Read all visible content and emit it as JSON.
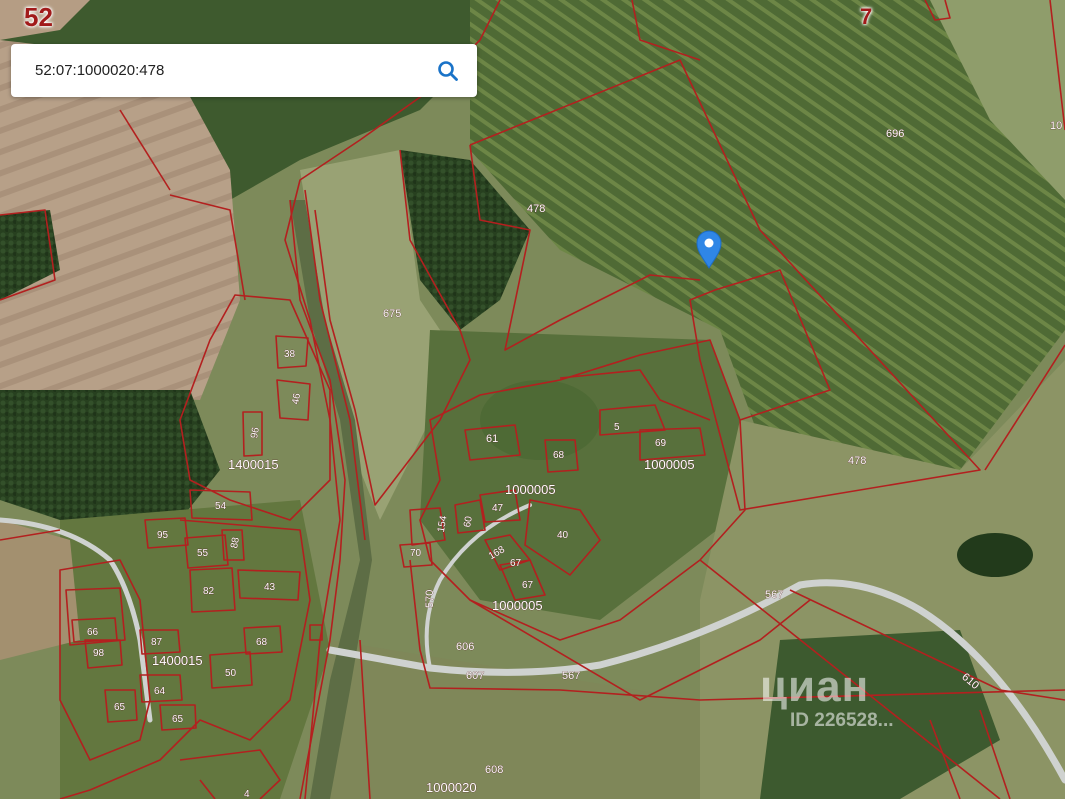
{
  "search": {
    "value": "52:07:1000020:478",
    "icon": "search-icon",
    "icon_color": "#1a73c8"
  },
  "marker": {
    "icon": "location-pin-icon",
    "color": "#2f86e6"
  },
  "regions": {
    "left": "52",
    "right": "7",
    "edge": "10"
  },
  "parcel_labels": {
    "p696": "696",
    "p478a": "478",
    "p478b": "478",
    "p675": "675",
    "p61": "61",
    "p5": "5",
    "p69": "69",
    "p68a": "68",
    "p1000005a": "1000005",
    "p1000005b": "1000005",
    "p1000005c": "1000005",
    "p154": "154",
    "p60": "60",
    "p47": "47",
    "p40": "40",
    "p70": "70",
    "p168": "168",
    "p67a": "67",
    "p67b": "67",
    "p570": "570",
    "p567a": "567",
    "p567b": "567",
    "p606": "606",
    "p607": "607",
    "p610": "610",
    "p608": "608",
    "p1000020": "1000020",
    "p38": "38",
    "p46": "46",
    "p96": "96",
    "p1400015a": "1400015",
    "p1400015b": "1400015",
    "p54": "54",
    "p95": "95",
    "p55": "55",
    "p88": "88",
    "p82": "82",
    "p43": "43",
    "p66": "66",
    "p87": "87",
    "p68b": "68",
    "p98": "98",
    "p50": "50",
    "p64": "64",
    "p65a": "65",
    "p65b": "65",
    "p4": "4"
  },
  "watermark": {
    "logo": "циан",
    "id": "ID 226528..."
  },
  "colors": {
    "boundary": "#b3201f",
    "road": "#cfd2d0",
    "field": "#b79c80",
    "forest": "#3c5a2c"
  }
}
